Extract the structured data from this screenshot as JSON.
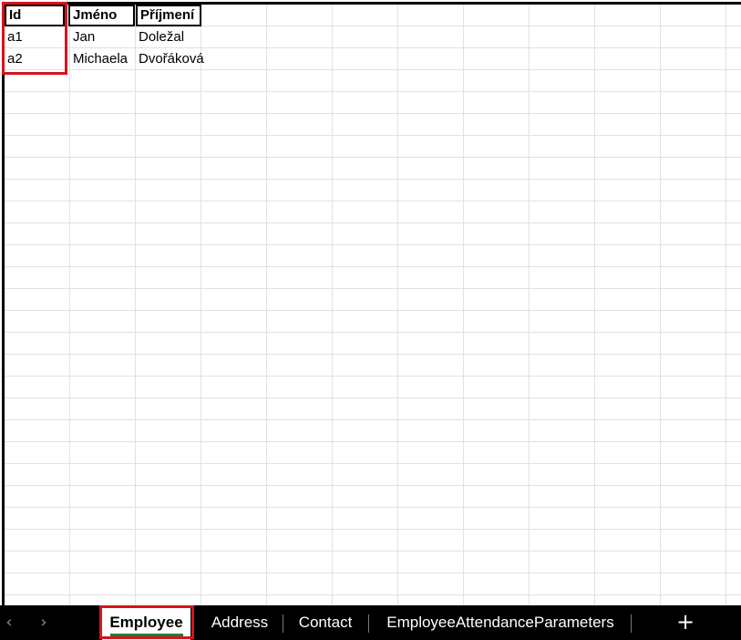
{
  "sheet": {
    "headers": [
      "Id",
      "Jméno",
      "Příjmení"
    ],
    "rows": [
      [
        "a1",
        "Jan",
        "Doležal"
      ],
      [
        "a2",
        "Michaela",
        "Dvořáková"
      ]
    ]
  },
  "tabs": {
    "prev_icon": "‹",
    "next_icon": "›",
    "items": [
      "Employee",
      "Address",
      "Contact",
      "EmployeeAttendanceParameters"
    ],
    "active": "Employee",
    "add_icon": "+"
  },
  "colors": {
    "highlight": "#d6141b",
    "active_tab_underline": "#1e7b3c",
    "gridline": "#e1e1e1"
  }
}
